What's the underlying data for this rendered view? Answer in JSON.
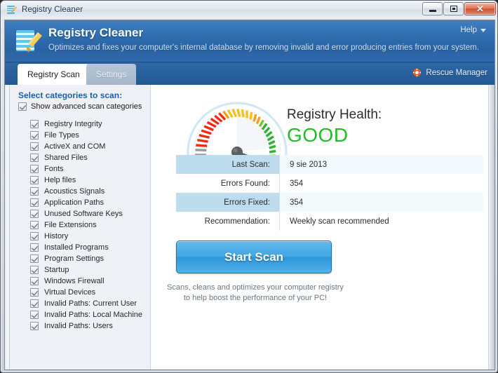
{
  "window": {
    "title": "Registry Cleaner",
    "icon": "registry-cleaner-icon",
    "controls": {
      "minimize": "minimize-button",
      "maximize": "restore-button",
      "close_glyph": "✕"
    }
  },
  "header": {
    "app_title": "Registry Cleaner",
    "app_subtitle": "Optimizes and fixes your computer's internal database by removing invalid and error producing entries from your system.",
    "help_label": "Help",
    "brand_blue": "#2f6dae"
  },
  "tabs": {
    "items": [
      {
        "label": "Registry Scan",
        "active": true
      },
      {
        "label": "Settings",
        "active": false
      }
    ],
    "rescue_manager_label": "Rescue Manager"
  },
  "sidebar": {
    "heading": "Select categories to scan:",
    "advanced_toggle": {
      "label": "Show advanced scan categories",
      "checked": true
    },
    "categories": [
      {
        "label": "Registry Integrity",
        "checked": true
      },
      {
        "label": "File Types",
        "checked": true
      },
      {
        "label": "ActiveX and COM",
        "checked": true
      },
      {
        "label": "Shared Files",
        "checked": true
      },
      {
        "label": "Fonts",
        "checked": true
      },
      {
        "label": "Help files",
        "checked": true
      },
      {
        "label": "Acoustics Signals",
        "checked": true
      },
      {
        "label": "Application Paths",
        "checked": true
      },
      {
        "label": "Unused Software Keys",
        "checked": true
      },
      {
        "label": "File Extensions",
        "checked": true
      },
      {
        "label": "History",
        "checked": true
      },
      {
        "label": "Installed Programs",
        "checked": true
      },
      {
        "label": "Program Settings",
        "checked": true
      },
      {
        "label": "Startup",
        "checked": true
      },
      {
        "label": "Windows Firewall",
        "checked": true
      },
      {
        "label": "Virtual Devices",
        "checked": true
      },
      {
        "label": "Invalid Paths: Current User",
        "checked": true
      },
      {
        "label": "Invalid Paths: Local Machine",
        "checked": true
      },
      {
        "label": "Invalid Paths: Users",
        "checked": true
      }
    ]
  },
  "main": {
    "health_title": "Registry Health:",
    "health_value": "GOOD",
    "health_color": "#1fbe21",
    "gauge": {
      "name": "registry-health-gauge",
      "needle_value_pct": 88,
      "zones": [
        "gray",
        "red",
        "orange",
        "yellow",
        "green"
      ]
    },
    "info_rows": [
      {
        "label": "Last Scan:",
        "value": "9 sie 2013",
        "shaded": true
      },
      {
        "label": "Errors Found:",
        "value": "354",
        "shaded": false
      },
      {
        "label": "Errors Fixed:",
        "value": "354",
        "shaded": true
      },
      {
        "label": "Recommendation:",
        "value": "Weekly scan recommended",
        "shaded": false
      }
    ],
    "scan_button_label": "Start Scan",
    "scan_note_line1": "Scans, cleans and optimizes your computer registry",
    "scan_note_line2": "to help boost the performance of your PC!"
  }
}
